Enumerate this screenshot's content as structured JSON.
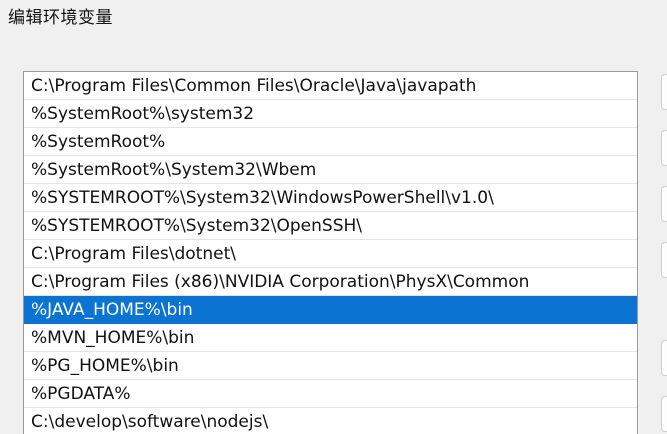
{
  "window": {
    "title": "编辑环境变量"
  },
  "path_list": {
    "selected_index": 8,
    "items": [
      "C:\\Program Files\\Common Files\\Oracle\\Java\\javapath",
      "%SystemRoot%\\system32",
      "%SystemRoot%",
      "%SystemRoot%\\System32\\Wbem",
      "%SYSTEMROOT%\\System32\\WindowsPowerShell\\v1.0\\",
      "%SYSTEMROOT%\\System32\\OpenSSH\\",
      "C:\\Program Files\\dotnet\\",
      "C:\\Program Files (x86)\\NVIDIA Corporation\\PhysX\\Common",
      "%JAVA_HOME%\\bin",
      "%MVN_HOME%\\bin",
      "%PG_HOME%\\bin",
      "%PGDATA%",
      "C:\\develop\\software\\nodejs\\"
    ]
  },
  "colors": {
    "selection": "#0b74d3",
    "background": "#f0f0f0"
  }
}
